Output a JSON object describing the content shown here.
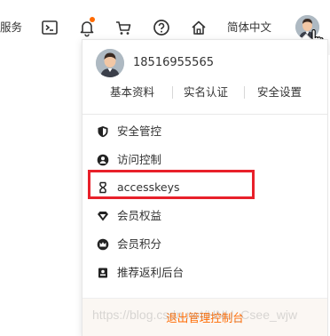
{
  "topbar": {
    "partial_label": "服务",
    "language_label": "简体中文",
    "icons": [
      "terminal-icon",
      "bell-icon",
      "cart-icon",
      "help-icon",
      "home-icon"
    ],
    "notify_color": "#ff6a00"
  },
  "user_panel": {
    "phone": "18516955565",
    "links": [
      "基本资料",
      "实名认证",
      "安全设置"
    ],
    "menu": [
      {
        "label": "安全管控",
        "icon": "shield-icon"
      },
      {
        "label": "访问控制",
        "icon": "user-icon"
      },
      {
        "label": "accesskeys",
        "icon": "key-bracket-icon"
      },
      {
        "label": "会员权益",
        "icon": "diamond-icon"
      },
      {
        "label": "会员积分",
        "icon": "crown-icon"
      },
      {
        "label": "推荐返利后台",
        "icon": "badge-icon"
      }
    ],
    "logout_label": "退出管理控制台",
    "highlight_color": "#e8202a"
  },
  "watermark": "https://blog.csdn.net/HNU_Csee_wjw"
}
